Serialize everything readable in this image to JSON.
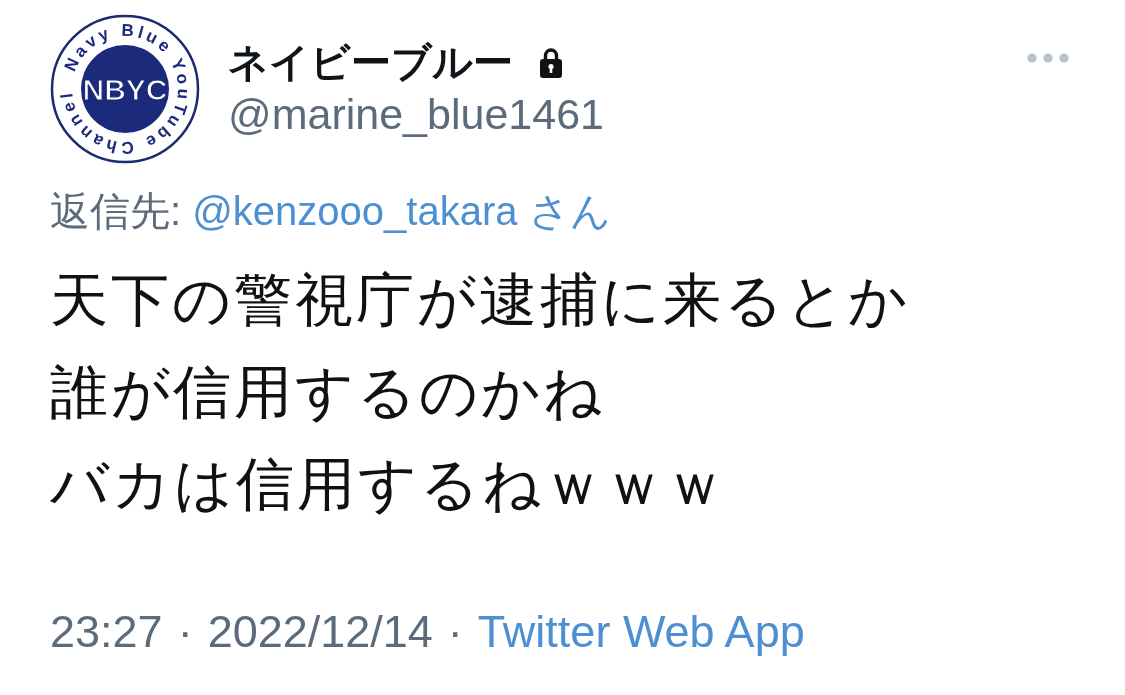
{
  "tweet": {
    "author": {
      "avatar": {
        "ring_text": "Navy Blue YouTube Channel",
        "center_text": "NBYC"
      },
      "display_name": "ネイビーブルー",
      "protected": true,
      "handle": "@marine_blue1461"
    },
    "reply_to": {
      "label": "返信先:",
      "handle": "@kenzooo_takara",
      "suffix": "さん"
    },
    "text_lines": [
      "天下の警視庁が逮捕に来るとか",
      "誰が信用するのかね",
      "バカは信用するねｗｗｗ"
    ],
    "meta": [
      {
        "kind": "time",
        "text": "23:27"
      },
      {
        "kind": "separator",
        "text": "·"
      },
      {
        "kind": "date",
        "text": "2022/12/14"
      },
      {
        "kind": "separator",
        "text": "·"
      },
      {
        "kind": "source",
        "text": "Twitter Web App"
      }
    ]
  }
}
